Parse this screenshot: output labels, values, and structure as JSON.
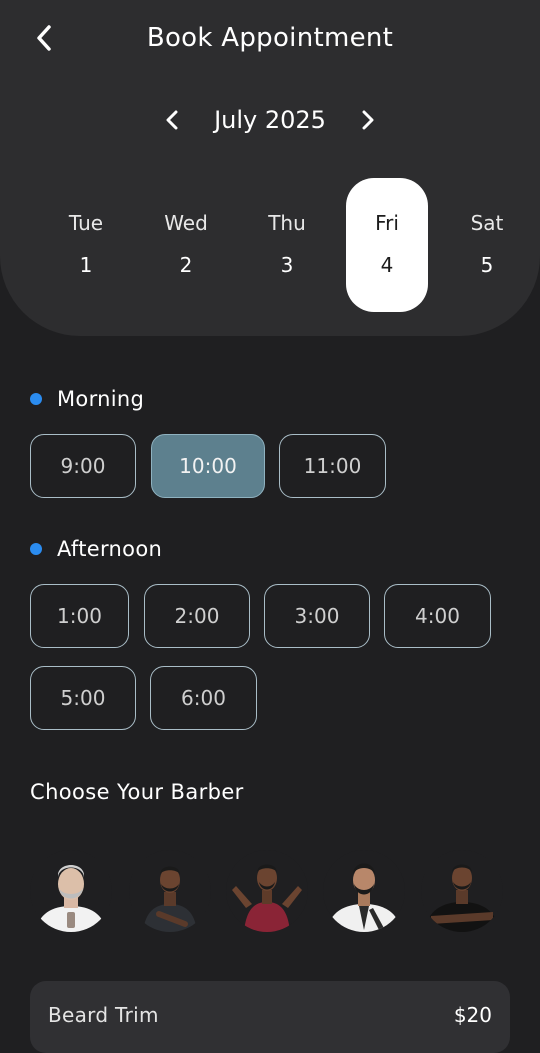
{
  "header": {
    "title": "Book Appointment"
  },
  "calendar": {
    "month_label": "July 2025",
    "days": [
      {
        "name": "Tue",
        "num": "1"
      },
      {
        "name": "Wed",
        "num": "2"
      },
      {
        "name": "Thu",
        "num": "3"
      },
      {
        "name": "Fri",
        "num": "4",
        "selected": true
      },
      {
        "name": "Sat",
        "num": "5"
      }
    ]
  },
  "morning": {
    "label": "Morning",
    "slots": [
      "9:00",
      "10:00",
      "11:00"
    ],
    "selected": "10:00"
  },
  "afternoon": {
    "label": "Afternoon",
    "slots": [
      "1:00",
      "2:00",
      "3:00",
      "4:00",
      "5:00",
      "6:00"
    ]
  },
  "barbers": {
    "title": "Choose Your Barber",
    "count": 5
  },
  "service": {
    "name": "Beard Trim",
    "price": "$20"
  },
  "colors": {
    "accent_dot": "#2b8cf0",
    "selected_slot": "#5d808e",
    "panel": "#2d2d2f",
    "background": "#1f1f21"
  }
}
